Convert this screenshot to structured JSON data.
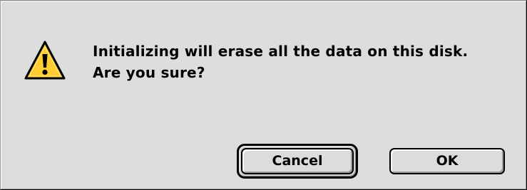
{
  "dialog": {
    "icon": "caution-icon",
    "message_line1": "Initializing will erase all the data on this disk.",
    "message_line2": "Are you sure?",
    "buttons": {
      "cancel_label": "Cancel",
      "ok_label": "OK"
    }
  },
  "colors": {
    "dialog_background": "#dddddd",
    "caution_yellow": "#ffcc33"
  }
}
